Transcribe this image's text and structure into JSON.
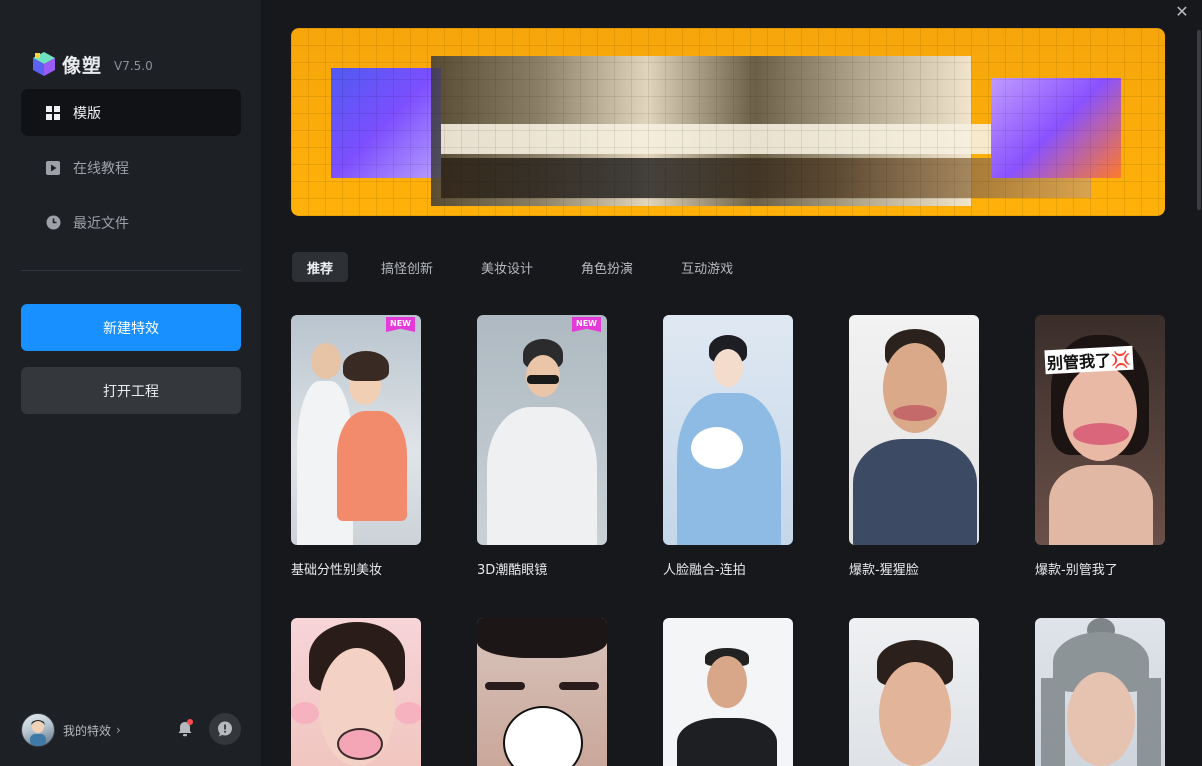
{
  "app": {
    "name": "像塑",
    "version": "V7.5.0"
  },
  "nav": [
    {
      "label": "模版",
      "icon": "grid-icon",
      "active": true
    },
    {
      "label": "在线教程",
      "icon": "play-icon",
      "active": false
    },
    {
      "label": "最近文件",
      "icon": "clock-icon",
      "active": false
    }
  ],
  "actions": {
    "new_effect": "新建特效",
    "open_project": "打开工程"
  },
  "user": {
    "label": "我的特效",
    "chevron": "›"
  },
  "window": {
    "close": "✕"
  },
  "tabs": [
    {
      "label": "推荐",
      "active": true
    },
    {
      "label": "搞怪创新",
      "active": false
    },
    {
      "label": "美妆设计",
      "active": false
    },
    {
      "label": "角色扮演",
      "active": false
    },
    {
      "label": "互动游戏",
      "active": false
    }
  ],
  "cards": [
    {
      "title": "基础分性别美妆",
      "badge": "NEW"
    },
    {
      "title": "3D潮酷眼镜",
      "badge": "NEW"
    },
    {
      "title": "人脸融合-连拍",
      "badge": ""
    },
    {
      "title": "爆款-猩猩脸",
      "badge": ""
    },
    {
      "title": "爆款-别管我了",
      "badge": "",
      "overlay_text": "别管我了💢"
    },
    {
      "title": "",
      "badge": ""
    },
    {
      "title": "",
      "badge": ""
    },
    {
      "title": "",
      "badge": ""
    },
    {
      "title": "",
      "badge": ""
    },
    {
      "title": "",
      "badge": ""
    }
  ],
  "colors": {
    "accent": "#1890ff",
    "new_badge": "#e43ad8",
    "notification_dot": "#ff4d4f"
  }
}
